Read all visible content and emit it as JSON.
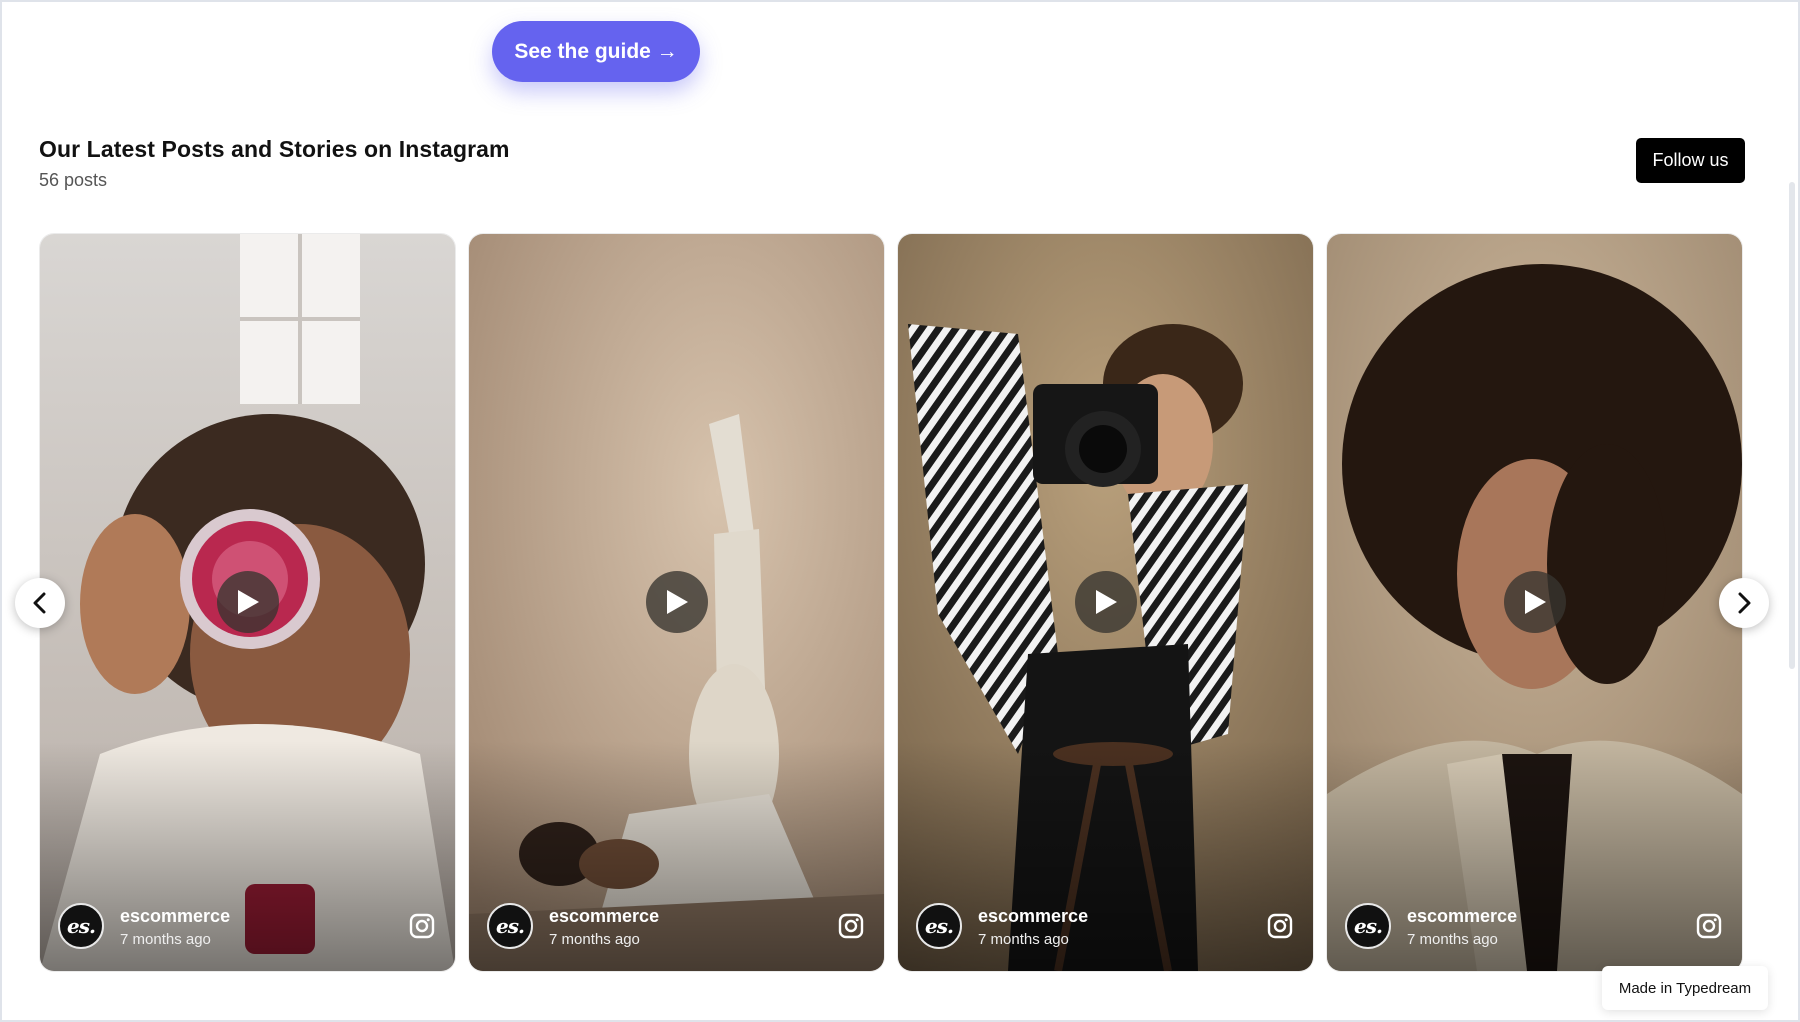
{
  "hero": {
    "guide_button_label": "See the guide →"
  },
  "feed": {
    "title": "Our Latest Posts and Stories on Instagram",
    "post_count": "56 posts",
    "follow_label": "Follow us",
    "posts": [
      {
        "account": "escommerce",
        "posted": "7 months ago",
        "avatar_text": "es.",
        "media": "video",
        "icon": "instagram-icon"
      },
      {
        "account": "escommerce",
        "posted": "7 months ago",
        "avatar_text": "es.",
        "media": "video",
        "icon": "instagram-icon"
      },
      {
        "account": "escommerce",
        "posted": "7 months ago",
        "avatar_text": "es.",
        "media": "video",
        "icon": "instagram-icon"
      },
      {
        "account": "escommerce",
        "posted": "7 months ago",
        "avatar_text": "es.",
        "media": "video",
        "icon": "instagram-icon"
      }
    ]
  },
  "badge": {
    "label": "Made in Typedream"
  },
  "colors": {
    "accent": "#6563ef",
    "follow_bg": "#000000"
  }
}
